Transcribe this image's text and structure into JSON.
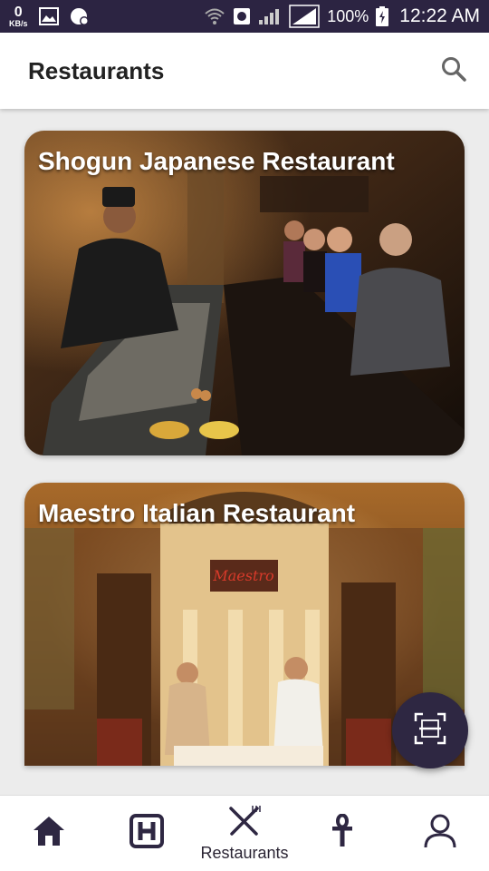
{
  "status_bar": {
    "speed_value": "0",
    "speed_unit": "KB/s",
    "battery": "100%",
    "time": "12:22 AM"
  },
  "app_bar": {
    "title": "Restaurants",
    "search_icon": "search-icon"
  },
  "restaurants": [
    {
      "name": "Shogun Japanese Restaurant"
    },
    {
      "name": "Maestro Italian Restaurant"
    }
  ],
  "fab": {
    "icon": "scan-icon"
  },
  "bottom_nav": {
    "items": [
      {
        "icon": "home-icon",
        "label": ""
      },
      {
        "icon": "hotel-icon",
        "label": ""
      },
      {
        "icon": "restaurant-icon",
        "label": "Restaurants",
        "active": true
      },
      {
        "icon": "ankh-icon",
        "label": ""
      },
      {
        "icon": "person-icon",
        "label": ""
      }
    ]
  },
  "colors": {
    "status_bar": "#2c2442",
    "accent": "#2e2742",
    "background": "#ececec"
  }
}
